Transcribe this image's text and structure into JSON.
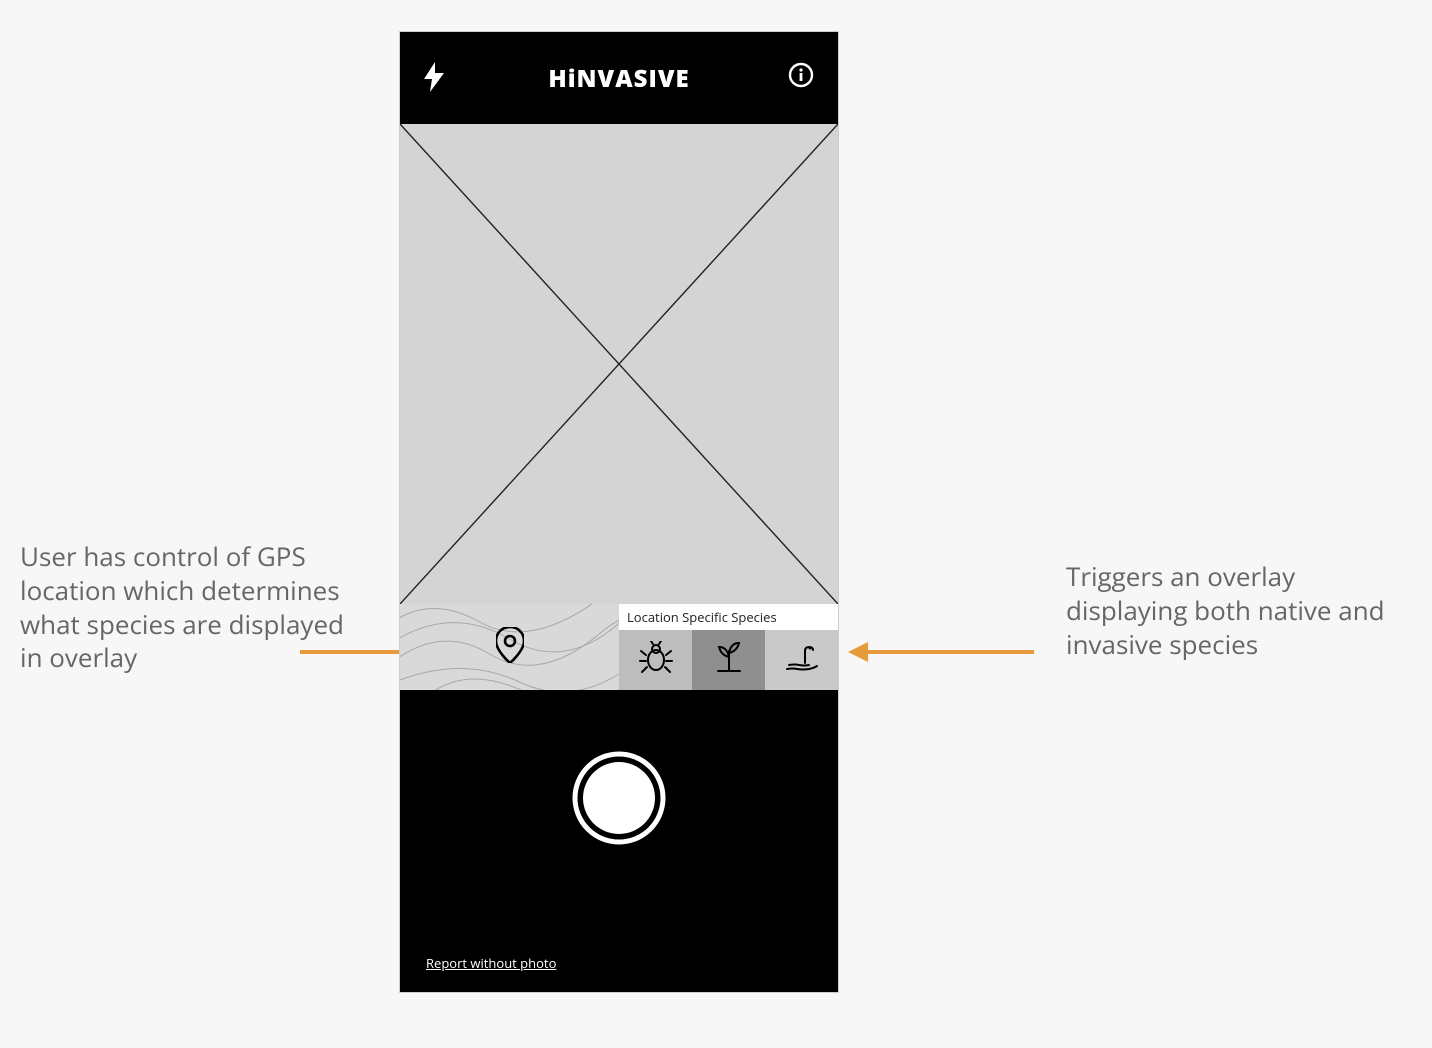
{
  "header": {
    "title": "HiNVASIVE",
    "flash_icon": "flash-icon",
    "info_icon": "info-icon"
  },
  "midbar": {
    "species_label": "Location Specific Species",
    "icons": [
      "bug-icon",
      "plant-icon",
      "snake-icon"
    ]
  },
  "footer": {
    "report_link": "Report without photo"
  },
  "annotations": {
    "left": "User has control of GPS location which determines what species are displayed in overlay",
    "right": "Triggers an overlay displaying both native and invasive species"
  },
  "colors": {
    "arrow": "#e69a3c"
  }
}
